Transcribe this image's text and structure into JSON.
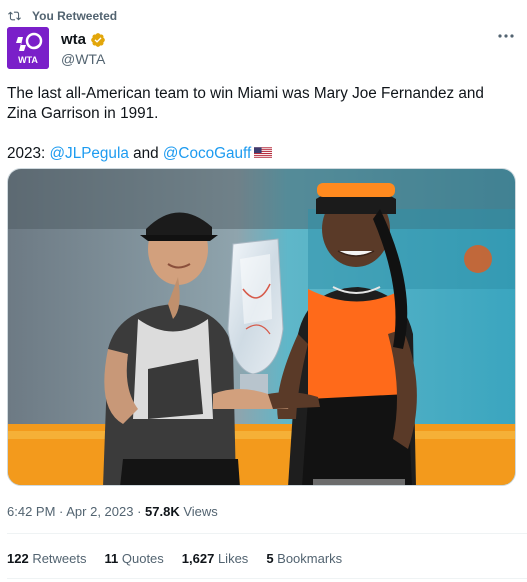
{
  "retweet_header": {
    "label": "You Retweeted",
    "icon": "retweet-icon"
  },
  "author": {
    "name": "wta",
    "handle": "@WTA",
    "avatar_text": "WTA",
    "avatar_color": "#7a1fc9",
    "verified_color": "#e2a60a"
  },
  "tweet": {
    "line1": "The last all-American team to win Miami was Mary Joe Fernandez and Zina Garrison in 1991.",
    "line2_prefix": "2023: ",
    "mention1": "@JLPegula",
    "conjunction": " and ",
    "mention2": "@CocoGauff",
    "flag_icon": "us-flag-icon"
  },
  "meta": {
    "time": "6:42 PM",
    "separator": " · ",
    "date": "Apr 2, 2023",
    "views_count": "57.8K",
    "views_label": " Views"
  },
  "stats": {
    "retweets_count": "122",
    "retweets_label": " Retweets",
    "quotes_count": "11",
    "quotes_label": " Quotes",
    "likes_count": "1,627",
    "likes_label": " Likes",
    "bookmarks_count": "5",
    "bookmarks_label": " Bookmarks"
  },
  "colors": {
    "link": "#1d9bf0",
    "secondary_text": "#536471",
    "text": "#0f1419"
  }
}
